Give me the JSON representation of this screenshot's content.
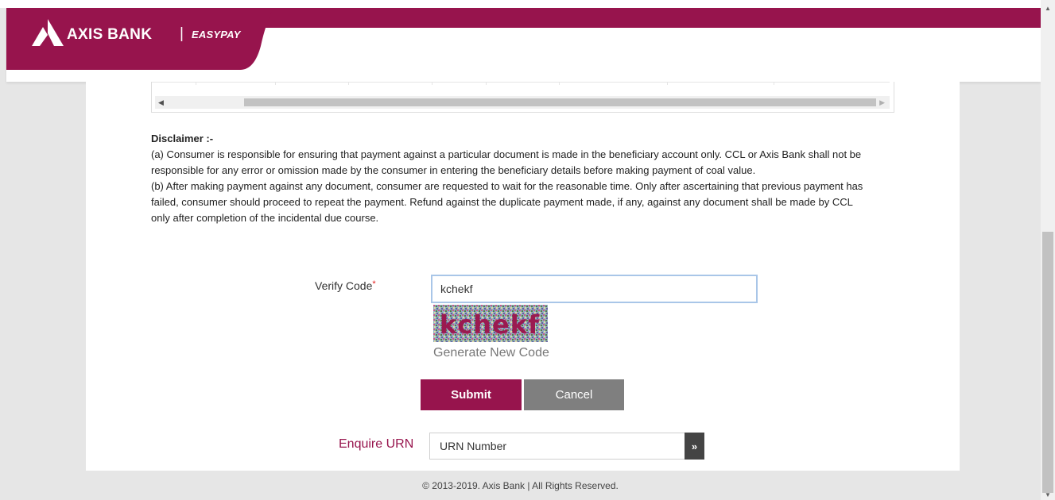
{
  "header": {
    "brand_name": "AXIS BANK",
    "separator": "|",
    "product_name": "EASYPAY",
    "brand_color": "#97144d"
  },
  "disclaimer": {
    "title": "Disclaimer :-",
    "paragraph_a": "(a) Consumer is responsible for ensuring that payment against a particular document is made in the beneficiary account only. CCL or Axis Bank shall not be responsible for any error or omission made by the consumer in entering the beneficiary details before making payment of coal value.",
    "paragraph_b": "(b) After making payment against any document, consumer are requested to wait for the reasonable time. Only after ascertaining that previous payment has failed, consumer should proceed to repeat the payment. Refund against the duplicate payment made, if any, against any document shall be made by CCL only after completion of the incidental due course."
  },
  "verify": {
    "label": "Verify Code",
    "required_mark": "*",
    "input_value": "kchekf",
    "captcha_text": "kchekf",
    "generate_link": "Generate New Code"
  },
  "actions": {
    "submit_label": "Submit",
    "cancel_label": "Cancel"
  },
  "enquire": {
    "label": "Enquire URN",
    "placeholder": "URN Number",
    "go_icon": "»"
  },
  "footer": {
    "copyright": "© 2013-2019. Axis Bank | All Rights Reserved."
  },
  "scroll_icons": {
    "left_arrow": "◀",
    "right_arrow": "▶",
    "up_arrow": "▲",
    "down_arrow": "▼"
  }
}
